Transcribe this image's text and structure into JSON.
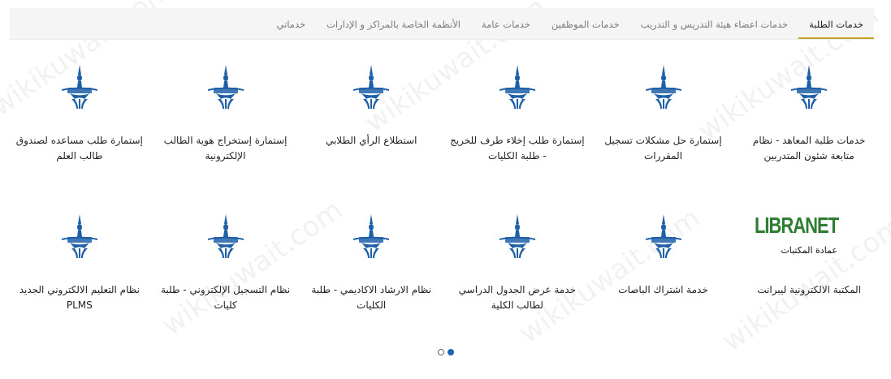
{
  "tabs": [
    {
      "label": "خدمات الطلبة",
      "active": true
    },
    {
      "label": "خدمات اعضاء هيئة التدريس و التدريب",
      "active": false
    },
    {
      "label": "خدمات الموظفين",
      "active": false
    },
    {
      "label": "خدمات عامة",
      "active": false
    },
    {
      "label": "الأنظمة الخاصة بالمراكز و الإدارات",
      "active": false
    },
    {
      "label": "خدماتي",
      "active": false
    }
  ],
  "cards": [
    {
      "label": "خدمات طلبة المعاهد - نظام متابعة شئون المتدربين",
      "icon": "paaet-logo-icon"
    },
    {
      "label": "إستمارة حل مشكلات تسجيل المقررات",
      "icon": "paaet-logo-icon"
    },
    {
      "label": "إستمارة طلب إخلاء طرف للخريج - طلبة الكليات",
      "icon": "paaet-logo-icon"
    },
    {
      "label": "استطلاع الرأي الطلابي",
      "icon": "paaet-logo-icon"
    },
    {
      "label": "إستمارة إستخراج هوية الطالب الإلكترونية",
      "icon": "paaet-logo-icon"
    },
    {
      "label": "إستمارة طلب مساعده لصندوق طالب العلم",
      "icon": "paaet-logo-icon"
    },
    {
      "label": "المكتبة الالكترونية ليبرانت",
      "icon": "libranet-logo-icon",
      "logo_text": "LIBRANET",
      "logo_subtext": "عمادة المكتبات"
    },
    {
      "label": "خدمة اشتراك الباصات",
      "icon": "paaet-logo-icon"
    },
    {
      "label": "خدمة عرض الجدول الدراسي لطالب الكلية",
      "icon": "paaet-logo-icon"
    },
    {
      "label": "نظام الارشاد الاكاديمي - طلبة الكليات",
      "icon": "paaet-logo-icon"
    },
    {
      "label": "نظام التسجيل الإلكتروني - طلبة كليات",
      "icon": "paaet-logo-icon"
    },
    {
      "label": "نظام التعليم الالكتروني الجديد PLMS",
      "icon": "paaet-logo-icon"
    }
  ],
  "pagination": {
    "current": 2,
    "total": 2
  },
  "watermark": {
    "text": "wikikuwait.com"
  },
  "colors": {
    "accent": "#c8a227",
    "logo_blue": "#1e5fa8",
    "dot_active": "#1e63b5"
  }
}
